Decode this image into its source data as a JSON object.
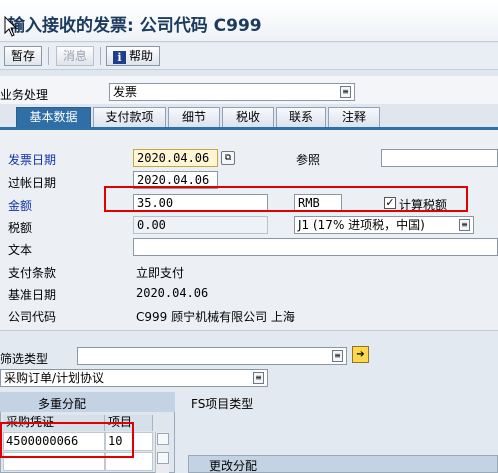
{
  "window": {
    "title": "输入接收的发票: 公司代码 C999"
  },
  "toolbar": {
    "hold": "暂存",
    "cancel": "消息",
    "help": "帮助"
  },
  "header": {
    "business_process_label": "业务处理",
    "business_process_value": "发票"
  },
  "tabs": [
    {
      "label": "基本数据",
      "active": true
    },
    {
      "label": "支付款项",
      "active": false
    },
    {
      "label": "细节",
      "active": false
    },
    {
      "label": "税收",
      "active": false
    },
    {
      "label": "联系",
      "active": false
    },
    {
      "label": "注释",
      "active": false
    }
  ],
  "basic": {
    "invoice_date_label": "发票日期",
    "invoice_date_value": "2020.04.06",
    "reference_label": "参照",
    "reference_value": "",
    "posting_date_label": "过帐日期",
    "posting_date_value": "2020.04.06",
    "amount_label": "金额",
    "amount_value": "35.00",
    "currency_value": "RMB",
    "calc_tax_label": "计算税额",
    "calc_tax_checked": true,
    "tax_amount_label": "税额",
    "tax_amount_value": "0.00",
    "tax_code_value": "J1 (17% 进项税，中国)",
    "text_label": "文本",
    "text_value": "",
    "payment_terms_label": "支付条款",
    "payment_terms_value": "立即支付",
    "baseline_date_label": "基准日期",
    "baseline_date_value": "2020.04.06",
    "company_code_label": "公司代码",
    "company_code_value": "C999 顾宁机械有限公司 上海"
  },
  "lower": {
    "filter_type_label": "筛选类型",
    "filter_type_value": "",
    "reference_doc_type": "采购订单/计划协议",
    "multi_assign_label": "多重分配",
    "fs_item_type_label": "FS项目类型",
    "change_split_label": "更改分配",
    "table": {
      "columns": [
        "采购凭证",
        "项目"
      ],
      "rows": [
        {
          "po": "4500000066",
          "item": "10"
        }
      ]
    }
  },
  "colors": {
    "accent": "#2f6fa6",
    "highlight": "#e00000",
    "label_blue": "#1133aa"
  }
}
